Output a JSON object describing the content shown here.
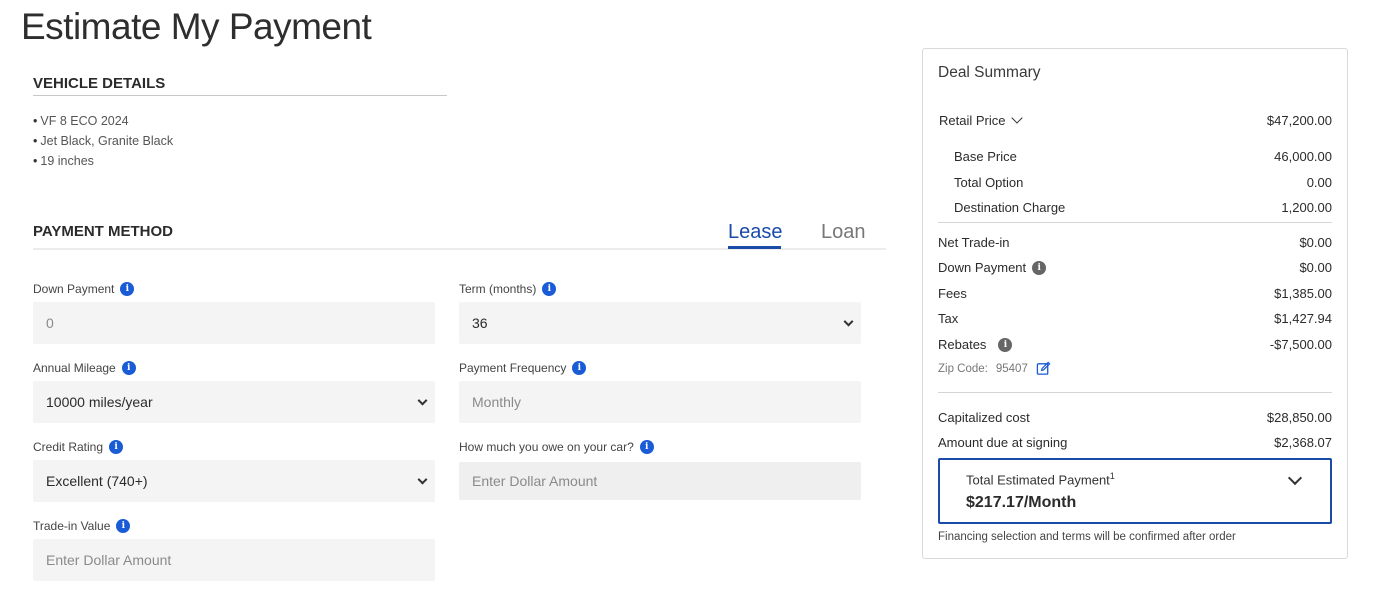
{
  "page": {
    "title": "Estimate My Payment"
  },
  "vehicle_details": {
    "heading": "VEHICLE DETAILS",
    "items": [
      "VF 8 ECO 2024",
      "Jet Black, Granite Black",
      "19 inches"
    ]
  },
  "payment_method": {
    "heading": "PAYMENT METHOD",
    "tabs": {
      "lease": "Lease",
      "loan": "Loan"
    },
    "selected_tab": "Lease",
    "down_payment": {
      "label": "Down Payment",
      "placeholder": "0"
    },
    "term": {
      "label": "Term (months)",
      "value": "36"
    },
    "annual_mileage": {
      "label": "Annual Mileage",
      "value": "10000 miles/year"
    },
    "payment_frequency": {
      "label": "Payment Frequency",
      "value": "Monthly"
    },
    "credit_rating": {
      "label": "Credit Rating",
      "value": "Excellent (740+)"
    },
    "owe_on_car": {
      "label": "How much you owe on your car?",
      "placeholder": "Enter Dollar Amount"
    },
    "trade_in": {
      "label": "Trade-in Value",
      "placeholder": "Enter Dollar Amount"
    }
  },
  "deal_summary": {
    "title": "Deal Summary",
    "retail_price": {
      "label": "Retail Price",
      "value": "$47,200.00"
    },
    "base_price": {
      "label": "Base Price",
      "value": "46,000.00"
    },
    "total_option": {
      "label": "Total Option",
      "value": "0.00"
    },
    "destination_charge": {
      "label": "Destination Charge",
      "value": "1,200.00"
    },
    "net_trade_in": {
      "label": "Net Trade-in",
      "value": "$0.00"
    },
    "down_payment": {
      "label": "Down Payment",
      "value": "$0.00"
    },
    "fees": {
      "label": "Fees",
      "value": "$1,385.00"
    },
    "tax": {
      "label": "Tax",
      "value": "$1,427.94"
    },
    "rebates": {
      "label": "Rebates",
      "value": "-$7,500.00"
    },
    "zip": {
      "label": "Zip Code:",
      "value": "95407"
    },
    "capitalized_cost": {
      "label": "Capitalized cost",
      "value": "$28,850.00"
    },
    "amount_due": {
      "label": "Amount due at signing",
      "value": "$2,368.07"
    },
    "total_payment": {
      "label": "Total Estimated Payment",
      "footnote_mark": "1",
      "value": "$217.17/Month"
    },
    "footnote": "Financing selection and terms will be confirmed after order"
  }
}
